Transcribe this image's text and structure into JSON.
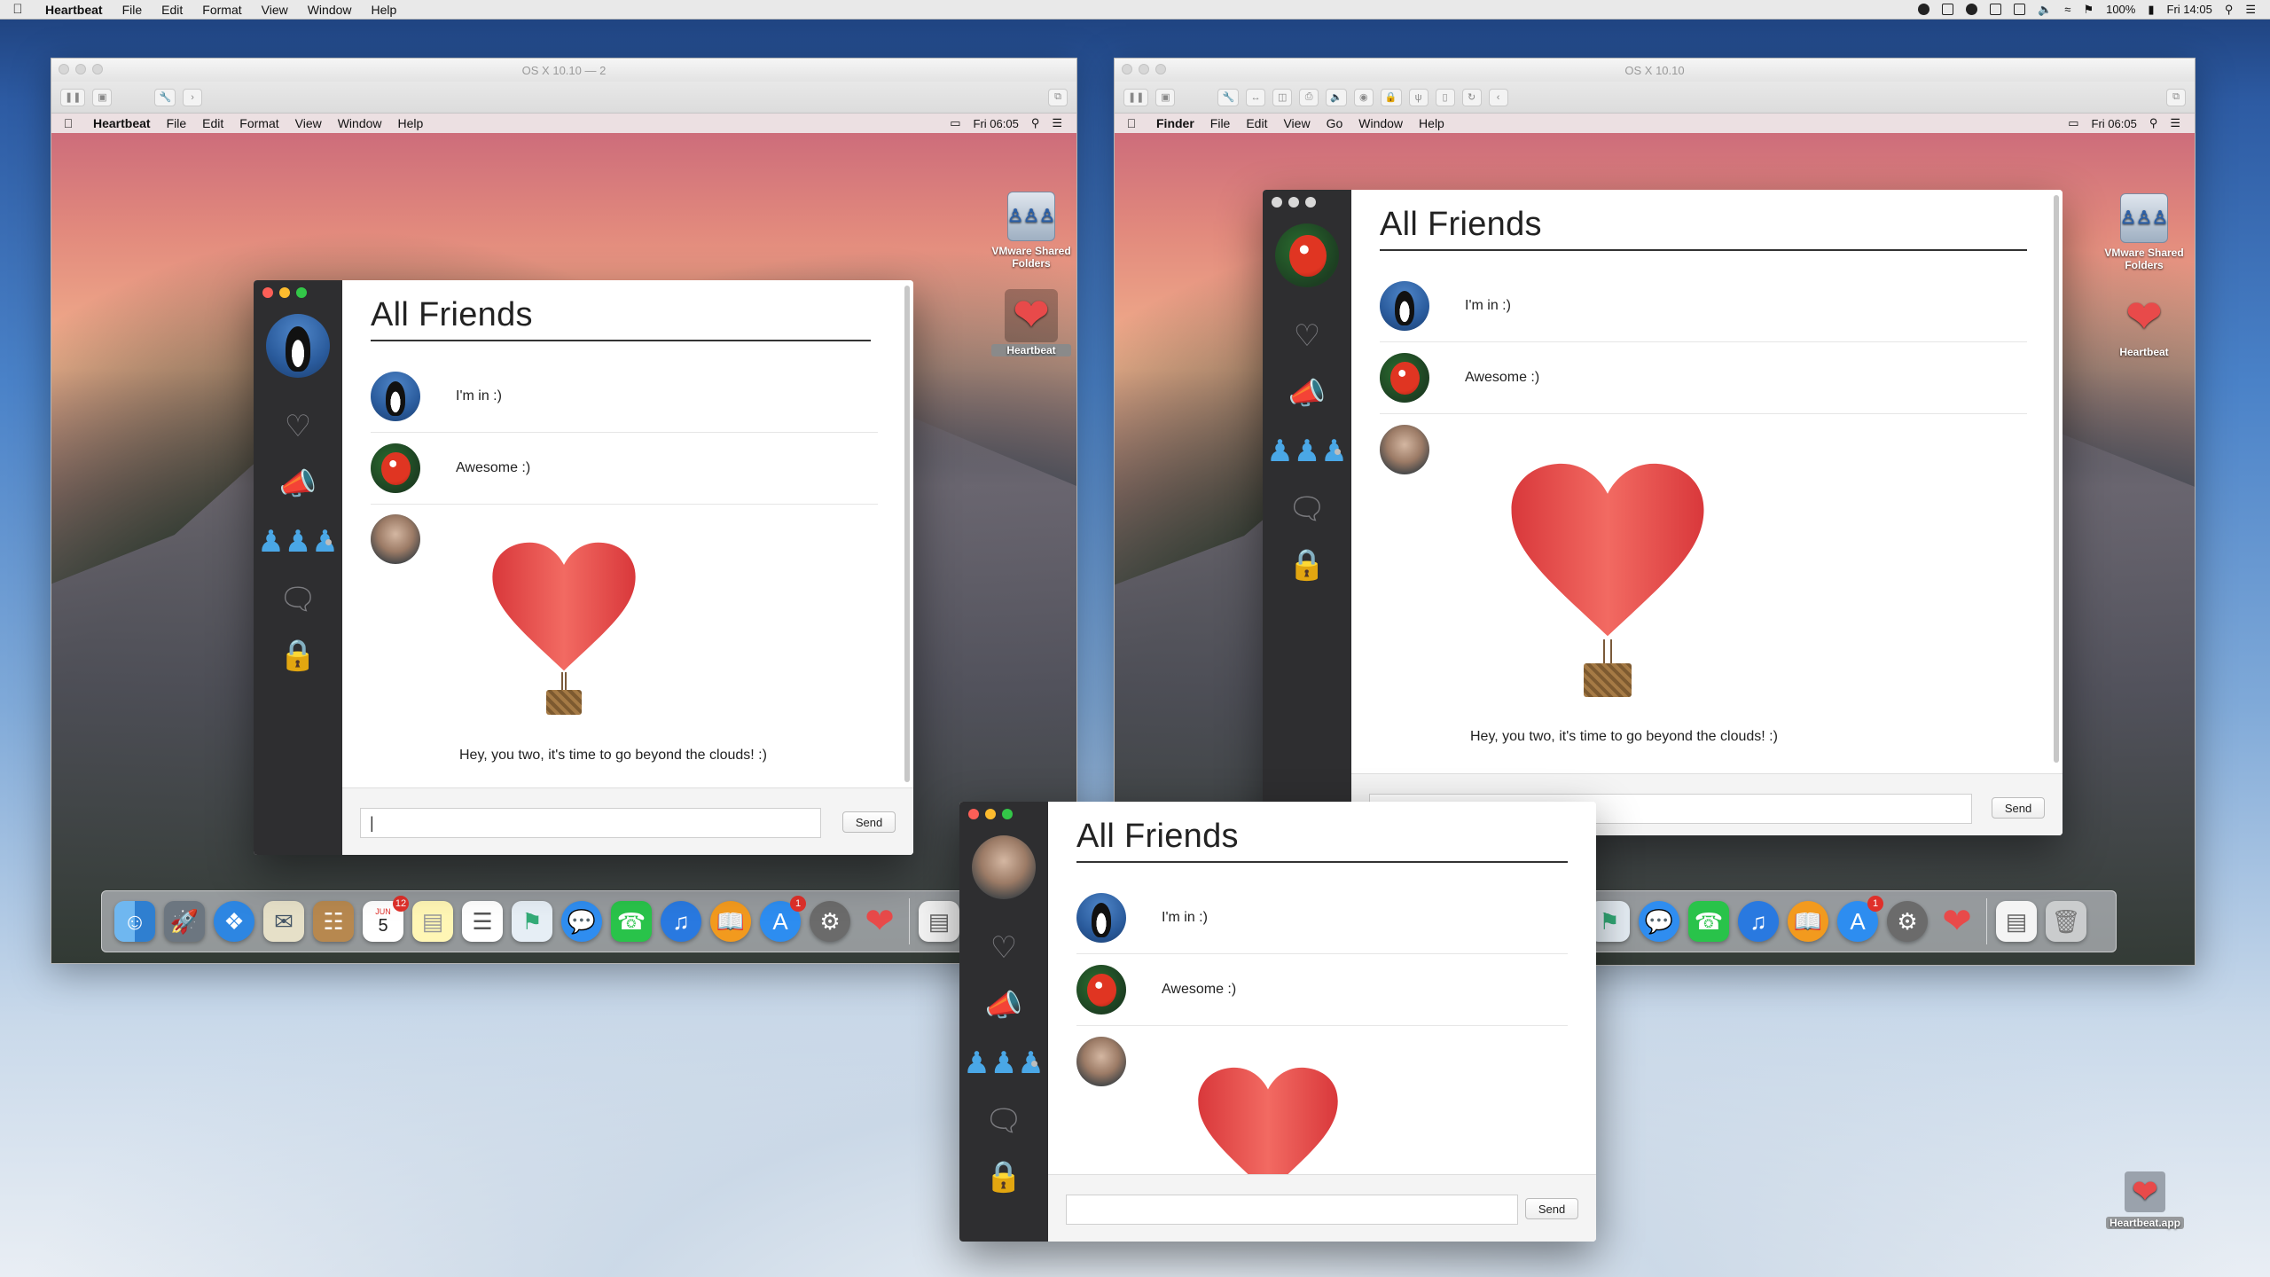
{
  "host_menubar": {
    "app_name": "Heartbeat",
    "menus": [
      "File",
      "Edit",
      "Format",
      "View",
      "Window",
      "Help"
    ],
    "battery": "100%",
    "clock": "Fri 14:05"
  },
  "vm_left": {
    "title": "OS X 10.10 — 2",
    "guest_menubar": {
      "app_name": "Heartbeat",
      "menus": [
        "File",
        "Edit",
        "Format",
        "View",
        "Window",
        "Help"
      ],
      "clock": "Fri 06:05"
    },
    "desktop_icons": [
      {
        "label": "VMware Shared Folders"
      },
      {
        "label": "Heartbeat"
      }
    ]
  },
  "vm_right": {
    "title": "OS X 10.10",
    "guest_menubar": {
      "app_name": "Finder",
      "menus": [
        "File",
        "Edit",
        "View",
        "Go",
        "Window",
        "Help"
      ],
      "clock": "Fri 06:05"
    },
    "desktop_icons": [
      {
        "label": "VMware Shared Folders"
      },
      {
        "label": "Heartbeat"
      }
    ]
  },
  "host_desktop_icon": {
    "label": "Heartbeat.app"
  },
  "app": {
    "title": "All Friends",
    "messages": [
      {
        "text": "I'm in :)"
      },
      {
        "text": "Awesome :)"
      }
    ],
    "balloon_caption": "Hey, you two, it's time to go beyond the clouds! :)",
    "send_label": "Send",
    "input_value_left": "|",
    "input_value": ""
  },
  "dock": {
    "calendar_month": "JUN",
    "calendar_day": "5",
    "calendar_badge": "12",
    "appstore_badge": "1"
  },
  "colors": {
    "accent": "#4aa7e6",
    "sidebar": "#2e2e30",
    "heart": "#e84a4a"
  }
}
